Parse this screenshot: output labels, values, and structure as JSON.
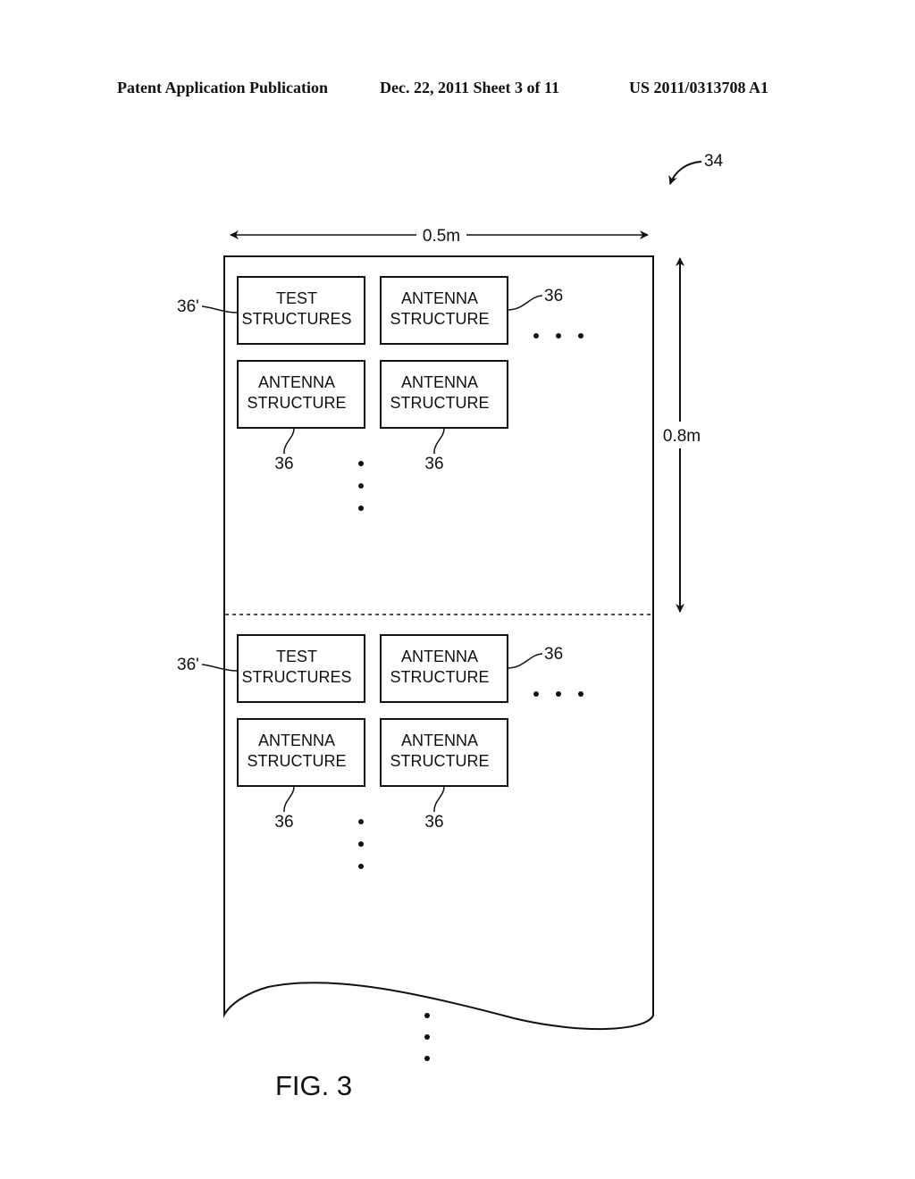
{
  "header": {
    "publication": "Patent Application Publication",
    "date_sheet": "Dec. 22, 2011   Sheet 3 of 11",
    "number": "US 2011/0313708 A1"
  },
  "figure": {
    "caption": "FIG. 3",
    "ref_sheet": "34",
    "width_dim": "0.5m",
    "height_dim": "0.8m",
    "sections": [
      {
        "boxes": [
          {
            "line1": "TEST",
            "line2": "STRUCTURES",
            "ref": "36'"
          },
          {
            "line1": "ANTENNA",
            "line2": "STRUCTURE",
            "ref": "36"
          },
          {
            "line1": "ANTENNA",
            "line2": "STRUCTURE",
            "ref": "36"
          },
          {
            "line1": "ANTENNA",
            "line2": "STRUCTURE",
            "ref": "36"
          }
        ]
      },
      {
        "boxes": [
          {
            "line1": "TEST",
            "line2": "STRUCTURES",
            "ref": "36'"
          },
          {
            "line1": "ANTENNA",
            "line2": "STRUCTURE",
            "ref": "36"
          },
          {
            "line1": "ANTENNA",
            "line2": "STRUCTURE",
            "ref": "36"
          },
          {
            "line1": "ANTENNA",
            "line2": "STRUCTURE",
            "ref": "36"
          }
        ]
      }
    ]
  }
}
